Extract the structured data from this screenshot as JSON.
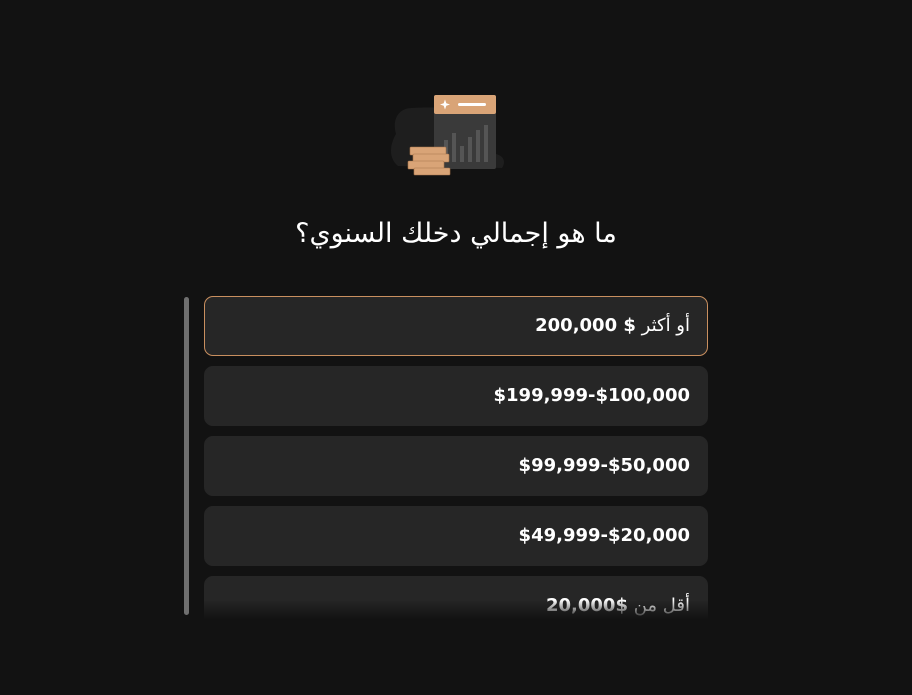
{
  "question": "ما هو إجمالي دخلك السنوي؟",
  "options": [
    {
      "amount": "200,000 $",
      "suffix": " أو أكثر"
    },
    {
      "amount": "$199,999-$100,000",
      "suffix": ""
    },
    {
      "amount": "$99,999-$50,000",
      "suffix": ""
    },
    {
      "amount": "$49,999-$20,000",
      "suffix": ""
    },
    {
      "prefix": "أقل من ",
      "amount": "$20,000"
    }
  ],
  "selected_index": 0,
  "colors": {
    "background": "#121212",
    "card": "#262626",
    "accent": "#c98f5f",
    "text": "#ffffff"
  },
  "icons": [
    "income-chart-icon",
    "coin-stack-icon"
  ]
}
